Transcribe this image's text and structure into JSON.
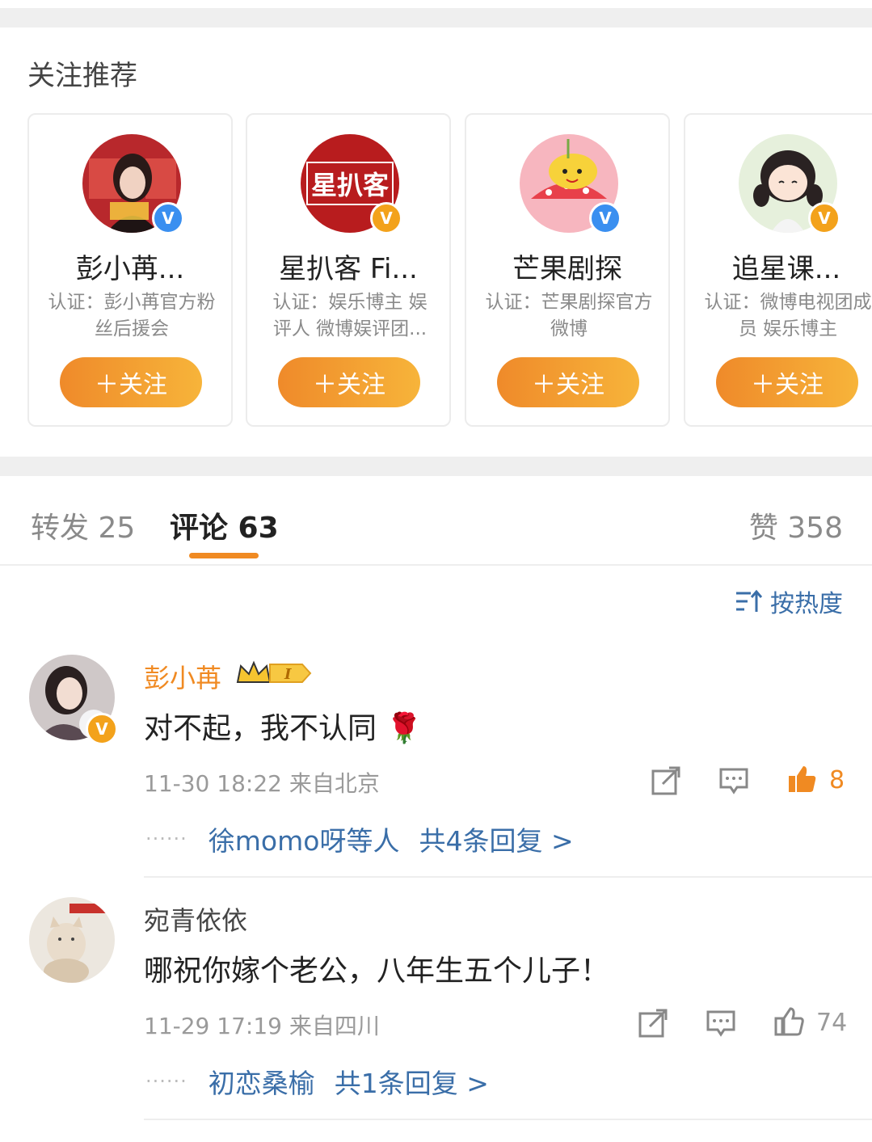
{
  "recommend": {
    "title": "关注推荐",
    "cards": [
      {
        "name": "彭小苒...",
        "desc": "认证：彭小苒官方粉丝后援会",
        "button": "＋关注",
        "badge": "blue",
        "avatar_icon": "portrait-woman-icon"
      },
      {
        "name": "星扒客 Fi...",
        "desc": "认证：娱乐博主 娱评人 微博娱评团...",
        "button": "＋关注",
        "badge": "gold",
        "avatar_icon": "xingbake-logo",
        "logo_text": "星扒客"
      },
      {
        "name": "芒果剧探",
        "desc": "认证：芒果剧探官方微博",
        "button": "＋关注",
        "badge": "blue",
        "avatar_icon": "mango-cartoon-icon"
      },
      {
        "name": "追星课...",
        "desc": "认证：微博电视团成员 娱乐博主",
        "button": "＋关注",
        "badge": "gold",
        "avatar_icon": "cartoon-girl-icon"
      }
    ],
    "badge_symbols": {
      "blue": "V",
      "gold": "V"
    }
  },
  "tabs": {
    "repost": "转发 25",
    "comment": "评论 63",
    "like": "赞 358"
  },
  "sort": {
    "label": "按热度"
  },
  "comments": [
    {
      "user": "彭小苒",
      "crown_level": "I",
      "text": "对不起，我不认同 🌹",
      "meta": "11-30 18:22 来自北京",
      "likes": "8",
      "liked": true,
      "reply_users": "徐momo呀等人",
      "reply_count": "共4条回复 >",
      "dots": "······"
    },
    {
      "user": "宛青依依",
      "text": "哪祝你嫁个老公，八年生五个儿子！",
      "meta": "11-29 17:19 来自四川",
      "likes": "74",
      "liked": false,
      "reply_users": "初恋桑榆",
      "reply_count": "共1条回复 >",
      "dots": "······"
    }
  ],
  "colors": {
    "accent_orange": "#f08a22",
    "link_blue": "#3a6ea8",
    "verified_blue": "#3a8ff0",
    "verified_gold": "#f3a21b"
  }
}
